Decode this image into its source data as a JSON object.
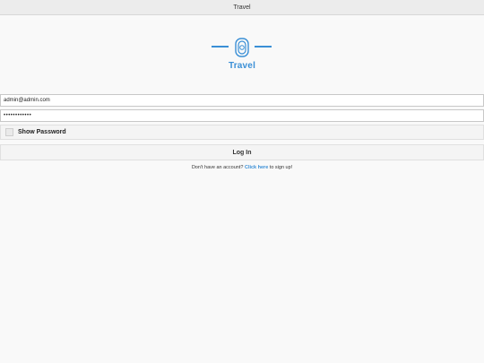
{
  "window": {
    "title": "Travel"
  },
  "logo": {
    "icon": "passport-stamp-icon",
    "text": "Travel",
    "color": "#3a8fd6"
  },
  "form": {
    "email_value": "admin@admin.com",
    "password_value": "••••••••••••",
    "show_password_label": "Show Password",
    "show_password_checked": false,
    "login_label": "Log In"
  },
  "signup": {
    "prefix": "Don't have an account?",
    "link_text": "Click here",
    "suffix": "to sign up!"
  }
}
